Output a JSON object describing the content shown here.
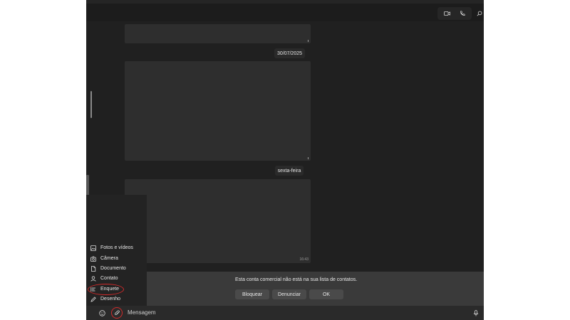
{
  "header": {
    "icons": [
      "video-call-icon",
      "voice-call-icon",
      "search-icon"
    ]
  },
  "chat": {
    "messages": [
      {
        "time": ""
      },
      {
        "time": ""
      },
      {
        "time": "16:43"
      }
    ],
    "date_chips": [
      "30/07/2025",
      "sexta-feira"
    ]
  },
  "attach_menu": {
    "items": [
      {
        "label": "Fotos e vídeos",
        "icon": "image-icon"
      },
      {
        "label": "Câmera",
        "icon": "camera-icon"
      },
      {
        "label": "Documento",
        "icon": "document-icon"
      },
      {
        "label": "Contato",
        "icon": "contact-icon"
      },
      {
        "label": "Enquete",
        "icon": "poll-icon"
      },
      {
        "label": "Desenho",
        "icon": "drawing-icon"
      }
    ]
  },
  "banner": {
    "text": "Esta conta comercial não está na sua lista de contatos.",
    "buttons": [
      "Bloquear",
      "Denunciar",
      "OK"
    ]
  },
  "composer": {
    "placeholder": "Mensagem"
  },
  "colors": {
    "highlight": "#d12a2a",
    "background": "#1c1c1c",
    "bubble": "#2e2e2e"
  }
}
